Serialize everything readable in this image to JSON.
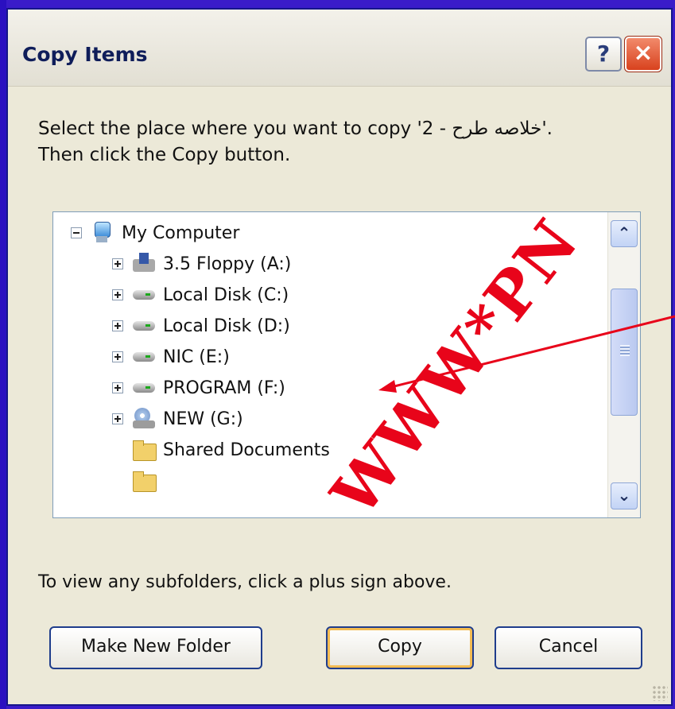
{
  "dialog": {
    "title": "Copy Items",
    "help_label": "?",
    "close_label": "×"
  },
  "instructions": {
    "line1": "Select the place where you want to copy '2 - خلاصه طرح'.",
    "line2": "Then click the Copy button."
  },
  "tree": {
    "items": [
      {
        "label": "My Computer",
        "icon": "my-computer-icon",
        "expander": "minus"
      },
      {
        "label": "3.5 Floppy (A:)",
        "icon": "floppy-drive-icon",
        "expander": "plus"
      },
      {
        "label": "Local Disk (C:)",
        "icon": "hard-disk-icon",
        "expander": "plus"
      },
      {
        "label": "Local Disk (D:)",
        "icon": "hard-disk-icon",
        "expander": "plus"
      },
      {
        "label": "NIC (E:)",
        "icon": "hard-disk-icon",
        "expander": "plus"
      },
      {
        "label": "PROGRAM (F:)",
        "icon": "hard-disk-icon",
        "expander": "plus"
      },
      {
        "label": "NEW (G:)",
        "icon": "cd-drive-icon",
        "expander": "plus"
      },
      {
        "label": "Shared Documents",
        "icon": "folder-icon",
        "expander": "none"
      }
    ],
    "scroll_up": "⌃",
    "scroll_down": "⌄"
  },
  "hint": "To view any subfolders, click a plus sign above.",
  "buttons": {
    "make_new_folder": "Make New Folder",
    "copy": "Copy",
    "cancel": "Cancel"
  },
  "watermark": "WWW*PN",
  "colors": {
    "dialog_bg": "#ece9d8",
    "frame": "#3a1cc9",
    "close_button": "#d8421e",
    "default_button_ring": "#f3bb52",
    "annotation_arrow": "#e8041a"
  }
}
